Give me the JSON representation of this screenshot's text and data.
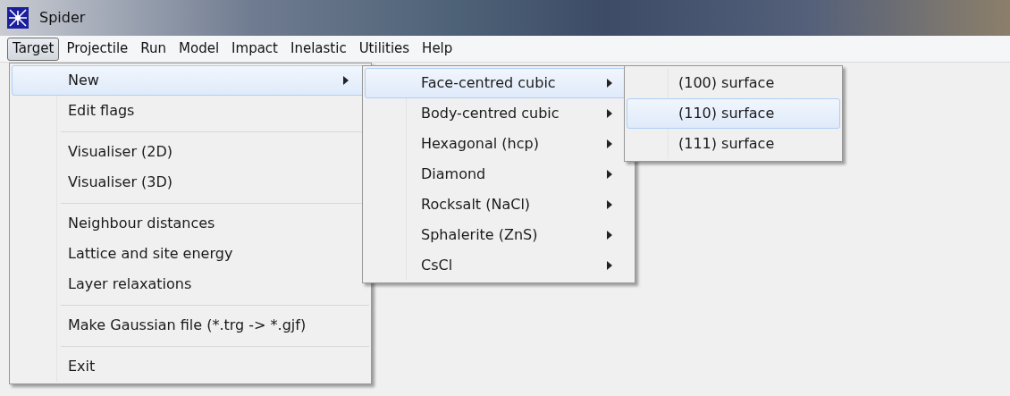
{
  "window": {
    "title": "Spider"
  },
  "menubar": [
    {
      "label": "Target",
      "selected": true
    },
    {
      "label": "Projectile",
      "selected": false
    },
    {
      "label": "Run",
      "selected": false
    },
    {
      "label": "Model",
      "selected": false
    },
    {
      "label": "Impact",
      "selected": false
    },
    {
      "label": "Inelastic",
      "selected": false
    },
    {
      "label": "Utilities",
      "selected": false
    },
    {
      "label": "Help",
      "selected": false
    }
  ],
  "menus": [
    {
      "items": [
        {
          "kind": "item",
          "label": "New",
          "submenu": true,
          "selected": true
        },
        {
          "kind": "item",
          "label": "Edit flags",
          "submenu": false,
          "selected": false
        },
        {
          "kind": "separator"
        },
        {
          "kind": "item",
          "label": "Visualiser (2D)",
          "submenu": false,
          "selected": false
        },
        {
          "kind": "item",
          "label": "Visualiser (3D)",
          "submenu": false,
          "selected": false
        },
        {
          "kind": "separator"
        },
        {
          "kind": "item",
          "label": "Neighbour distances",
          "submenu": false,
          "selected": false
        },
        {
          "kind": "item",
          "label": "Lattice and site energy",
          "submenu": false,
          "selected": false
        },
        {
          "kind": "item",
          "label": "Layer relaxations",
          "submenu": false,
          "selected": false
        },
        {
          "kind": "separator"
        },
        {
          "kind": "item",
          "label": "Make Gaussian file (*.trg -> *.gjf)",
          "submenu": false,
          "selected": false
        },
        {
          "kind": "separator"
        },
        {
          "kind": "item",
          "label": "Exit",
          "submenu": false,
          "selected": false
        }
      ]
    },
    {
      "items": [
        {
          "kind": "item",
          "label": "Face-centred cubic",
          "submenu": true,
          "selected": true
        },
        {
          "kind": "item",
          "label": "Body-centred cubic",
          "submenu": true,
          "selected": false
        },
        {
          "kind": "item",
          "label": "Hexagonal (hcp)",
          "submenu": true,
          "selected": false
        },
        {
          "kind": "item",
          "label": "Diamond",
          "submenu": true,
          "selected": false
        },
        {
          "kind": "item",
          "label": "Rocksalt (NaCl)",
          "submenu": true,
          "selected": false
        },
        {
          "kind": "item",
          "label": "Sphalerite (ZnS)",
          "submenu": true,
          "selected": false
        },
        {
          "kind": "item",
          "label": "CsCl",
          "submenu": true,
          "selected": false
        }
      ]
    },
    {
      "items": [
        {
          "kind": "item",
          "label": "(100) surface",
          "submenu": false,
          "selected": false
        },
        {
          "kind": "item",
          "label": "(110) surface",
          "submenu": false,
          "selected": true
        },
        {
          "kind": "item",
          "label": "(111) surface",
          "submenu": false,
          "selected": false
        }
      ]
    }
  ]
}
